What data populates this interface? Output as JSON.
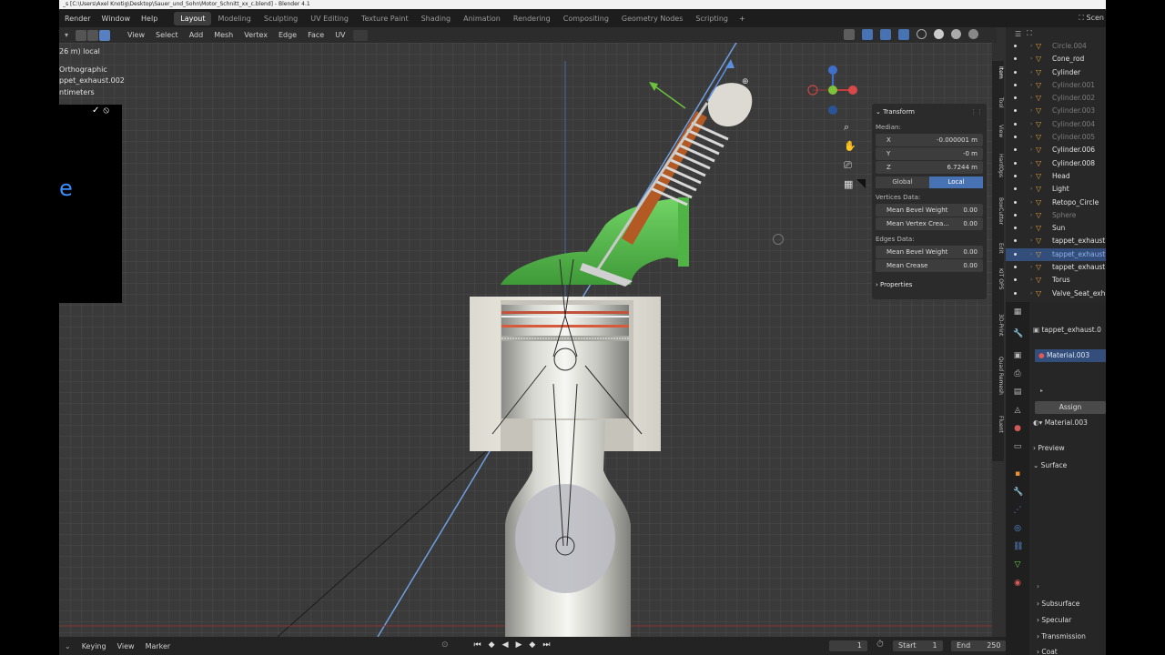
{
  "window": {
    "title": "_s [C:\\Users\\Axel Knotig\\Desktop\\Sauer_und_Sohn\\Motor_Schnitt_xx_c.blend] - Blender 4.1"
  },
  "menus": [
    "Render",
    "Window",
    "Help"
  ],
  "workspaces": [
    "Layout",
    "Modeling",
    "Sculpting",
    "UV Editing",
    "Texture Paint",
    "Shading",
    "Animation",
    "Rendering",
    "Compositing",
    "Geometry Nodes",
    "Scripting"
  ],
  "workspace_add": "+",
  "scene_label": "Scen",
  "viewport_menus": [
    "View",
    "Select",
    "Add",
    "Mesh",
    "Vertex",
    "Edge",
    "Face",
    "UV"
  ],
  "viewport_info": {
    "line1": "26 m) local",
    "line2": "Orthographic",
    "line3": "ppet_exhaust.002",
    "line4": "ntimeters"
  },
  "operator_bar": {
    "confirm": "✓",
    "cancel": "⦸"
  },
  "transform_panel": {
    "title": "Transform",
    "median_label": "Median:",
    "x": {
      "label": "X",
      "value": "-0.000001 m"
    },
    "y": {
      "label": "Y",
      "value": "-0 m"
    },
    "z": {
      "label": "Z",
      "value": "6.7244 m"
    },
    "toggle": {
      "global": "Global",
      "local": "Local"
    },
    "vertices_label": "Vertices Data:",
    "vertex_fields": [
      {
        "label": "Mean Bevel Weight",
        "value": "0.00"
      },
      {
        "label": "Mean Vertex Crea...",
        "value": "0.00"
      }
    ],
    "edges_label": "Edges Data:",
    "edge_fields": [
      {
        "label": "Mean Bevel Weight",
        "value": "0.00"
      },
      {
        "label": "Mean Crease",
        "value": "0.00"
      }
    ],
    "properties": "Properties"
  },
  "side_tabs": [
    "Item",
    "Tool",
    "View",
    "HardOps",
    "BoxCutter",
    "Edit",
    "KIT OPS",
    "3D-Print",
    "Quad Remesh",
    "Fluent"
  ],
  "outliner": {
    "rows": [
      {
        "label": "Circle.004",
        "dim": true
      },
      {
        "label": "Cone_rod",
        "dim": false
      },
      {
        "label": "Cylinder",
        "dim": false
      },
      {
        "label": "Cylinder.001",
        "dim": true
      },
      {
        "label": "Cylinder.002",
        "dim": true
      },
      {
        "label": "Cylinder.003",
        "dim": true
      },
      {
        "label": "Cylinder.004",
        "dim": true
      },
      {
        "label": "Cylinder.005",
        "dim": true
      },
      {
        "label": "Cylinder.006",
        "dim": false
      },
      {
        "label": "Cylinder.008",
        "dim": false
      },
      {
        "label": "Head",
        "dim": false
      },
      {
        "label": "Light",
        "dim": false
      },
      {
        "label": "Retopo_Circle",
        "dim": false
      },
      {
        "label": "Sphere",
        "dim": true
      },
      {
        "label": "Sun",
        "dim": false
      },
      {
        "label": "tappet_exhaust",
        "dim": false
      },
      {
        "label": "tappet_exhaust",
        "dim": false,
        "selected": true
      },
      {
        "label": "tappet_exhaust",
        "dim": false
      },
      {
        "label": "Torus",
        "dim": false
      },
      {
        "label": "Valve_Seat_exh",
        "dim": false
      }
    ]
  },
  "properties_editor": {
    "object_name": "tappet_exhaust.0",
    "material_slot": "Material.003",
    "assign": "Assign",
    "material_name": "Material.003",
    "preview": "Preview",
    "surface": "Surface",
    "subsurface": "Subsurface",
    "specular": "Specular",
    "transmission": "Transmission",
    "coat": "Coat"
  },
  "timeline": {
    "menus": [
      "Keying",
      "View",
      "Marker"
    ],
    "current_frame": "1",
    "start_label": "Start",
    "start_value": "1",
    "end_label": "End",
    "end_value": "250"
  },
  "colors": {
    "accent": "#4772b3",
    "selected_row": "#334e7b",
    "background": "#303030",
    "mesh_green": "#55b84a"
  }
}
